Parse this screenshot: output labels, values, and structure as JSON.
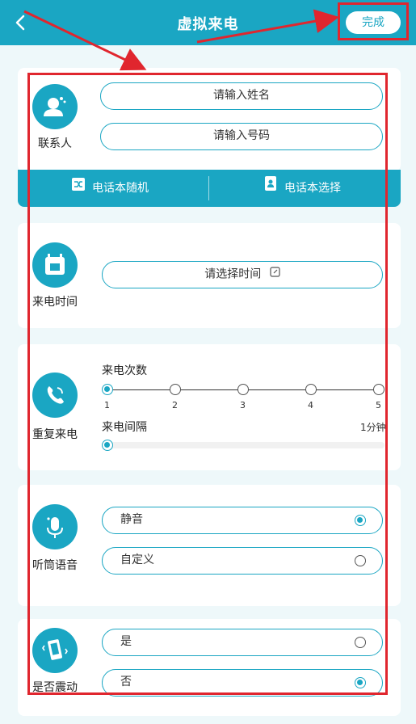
{
  "header": {
    "title": "虚拟来电",
    "done_label": "完成"
  },
  "contact": {
    "section_label": "联系人",
    "name_placeholder": "请输入姓名",
    "number_placeholder": "请输入号码",
    "phonebook_random": "电话本随机",
    "phonebook_select": "电话本选择"
  },
  "call_time": {
    "section_label": "来电时间",
    "select_label": "请选择时间"
  },
  "repeat": {
    "section_label": "重复来电",
    "count_label": "来电次数",
    "count_ticks": [
      "1",
      "2",
      "3",
      "4",
      "5"
    ],
    "count_value": 1,
    "interval_label": "来电间隔",
    "interval_value": "1分钟"
  },
  "voice": {
    "section_label": "听筒语音",
    "options": [
      {
        "label": "静音",
        "selected": true
      },
      {
        "label": "自定义",
        "selected": false
      }
    ]
  },
  "vibrate": {
    "section_label": "是否震动",
    "options": [
      {
        "label": "是",
        "selected": false
      },
      {
        "label": "否",
        "selected": true
      }
    ]
  },
  "colors": {
    "accent": "#1aa6c3",
    "annotation": "#e0262e",
    "background": "#eef8fa"
  },
  "icons": [
    "back-icon",
    "contact-icon",
    "shuffle-icon",
    "phonebook-icon",
    "calendar-icon",
    "phone-icon",
    "microphone-icon",
    "vibrate-icon",
    "edit-icon"
  ]
}
